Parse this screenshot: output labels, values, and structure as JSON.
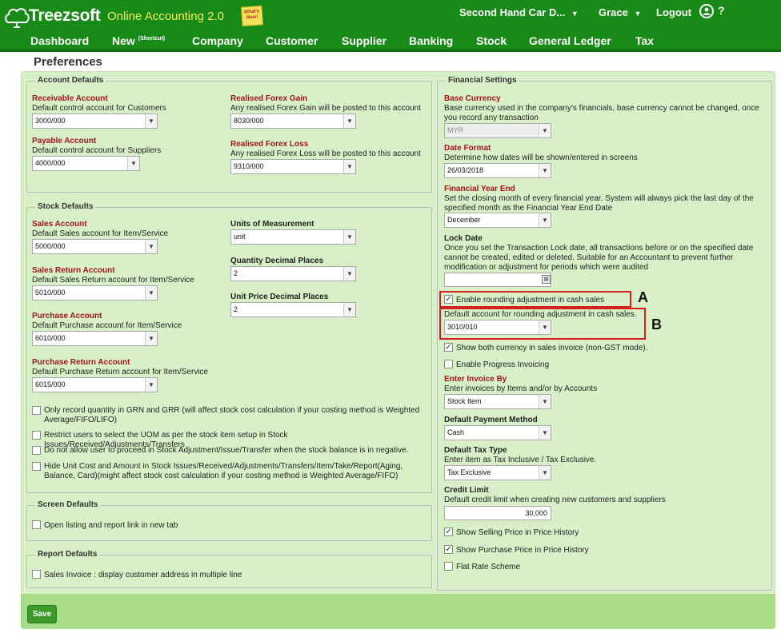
{
  "header": {
    "brand": "Treezsoft",
    "tagline": "Online Accounting 2.0",
    "sticky_note": "What's New!",
    "company": "Second Hand Car D...",
    "user": "Grace",
    "logout": "Logout",
    "help": "?",
    "nav": [
      {
        "label": "Dashboard"
      },
      {
        "label": "New",
        "sup": "(Shortcut)"
      },
      {
        "label": "Company"
      },
      {
        "label": "Customer"
      },
      {
        "label": "Supplier"
      },
      {
        "label": "Banking"
      },
      {
        "label": "Stock"
      },
      {
        "label": "General Ledger"
      },
      {
        "label": "Tax"
      }
    ]
  },
  "page_title": "Preferences",
  "account_defaults": {
    "legend": "Account Defaults",
    "receivable": {
      "label": "Receivable Account",
      "desc": "Default control account for Customers",
      "value": "3000/000"
    },
    "payable": {
      "label": "Payable Account",
      "desc": "Default control account for Suppliers",
      "value": "4000/000"
    },
    "forex_gain": {
      "label": "Realised Forex Gain",
      "desc": "Any realised Forex Gain will be posted to this account",
      "value": "8030/000"
    },
    "forex_loss": {
      "label": "Realised Forex Loss",
      "desc": "Any realised Forex Loss will be posted to this account",
      "value": "9310/000"
    }
  },
  "stock_defaults": {
    "legend": "Stock Defaults",
    "sales": {
      "label": "Sales Account",
      "desc": "Default Sales account for Item/Service",
      "value": "5000/000"
    },
    "sales_return": {
      "label": "Sales Return Account",
      "desc": "Default Sales Return account for Item/Service",
      "value": "5010/000"
    },
    "purchase": {
      "label": "Purchase Account",
      "desc": "Default Purchase account for Item/Service",
      "value": "6010/000"
    },
    "purchase_return": {
      "label": "Purchase Return Account",
      "desc": "Default Purchase Return account for Item/Service",
      "value": "6015/000"
    },
    "uom": {
      "label": "Units of Measurement",
      "value": "unit"
    },
    "qty_decimal": {
      "label": "Quantity Decimal Places",
      "value": "2"
    },
    "price_decimal": {
      "label": "Unit Price Decimal Places",
      "value": "2"
    },
    "options": [
      {
        "text": "Only record quantity in GRN and GRR (will affect stock cost calculation if your costing method is Weighted Average/FIFO/LIFO)",
        "checked": false
      },
      {
        "text": "Restrict users to select the UOM as per the stock item setup in Stock Issues/Received/Adjustments/Transfers",
        "checked": false
      },
      {
        "text": "Do not allow user to proceed in Stock Adjustment/Issue/Transfer when the stock balance is in negative.",
        "checked": false
      },
      {
        "text": "Hide Unit Cost and Amount in Stock Issues/Received/Adjustments/Transfers/Item/Take/Report(Aging, Balance, Card)(might affect stock cost calculation if your costing method is Weighted Average/FIFO)",
        "checked": false
      }
    ]
  },
  "screen_defaults": {
    "legend": "Screen Defaults",
    "option": {
      "text": "Open listing and report link in new tab",
      "checked": false
    }
  },
  "report_defaults": {
    "legend": "Report Defaults",
    "option": {
      "text": "Sales Invoice : display customer address in multiple line",
      "checked": false
    }
  },
  "financial_settings": {
    "legend": "Financial Settings",
    "base_currency": {
      "label": "Base Currency",
      "desc": "Base currency used in the company's financials, base currency cannot be changed, once you record any transaction",
      "value": "MYR"
    },
    "date_format": {
      "label": "Date Format",
      "desc": "Determine how dates will be shown/entered in screens",
      "value": "26/03/2018"
    },
    "fy_end": {
      "label": "Financial Year End",
      "desc": "Set the closing month of every financial year. System will always pick the last day of the specified month as the Financial Year End Date",
      "value": "December"
    },
    "lock_date": {
      "label": "Lock Date",
      "desc": "Once you set the Transaction Lock date, all transactions before or on the specified date cannot be created, edited or deleted. Suitable for an Accountant to prevent further modification or adjustment for periods which were audited",
      "value": ""
    },
    "rounding": {
      "text": "Enable rounding adjustment in cash sales",
      "checked": true,
      "marker": "A"
    },
    "rounding_account": {
      "desc": "Default account for rounding adjustment in cash sales.",
      "value": "3010/010",
      "marker": "B"
    },
    "show_both_currency": {
      "text": "Show both currency in sales invoice (non-GST mode).",
      "checked": true
    },
    "progress_invoicing": {
      "text": "Enable Progress Invoicing",
      "checked": false
    },
    "enter_invoice_by": {
      "label": "Enter Invoice By",
      "desc": "Enter invoices by Items and/or by Accounts",
      "value": "Stock Item"
    },
    "payment_method": {
      "label": "Default Payment Method",
      "value": "Cash"
    },
    "tax_type": {
      "label": "Default Tax Type",
      "desc": "Enter item as Tax Inclusive / Tax Exclusive.",
      "value": "Tax Exclusive"
    },
    "credit_limit": {
      "label": "Credit Limit",
      "desc": "Default credit limit when creating new customers and suppliers",
      "value": "30,000"
    },
    "show_selling_price": {
      "text": "Show Selling Price in Price History",
      "checked": true
    },
    "show_purchase_price": {
      "text": "Show Purchase Price in Price History",
      "checked": true
    },
    "flat_rate": {
      "text": "Flat Rate Scheme",
      "checked": false
    }
  },
  "save_label": "Save",
  "colors": {
    "header": "#178a17",
    "tagline": "#f2ef5f",
    "panel": "#d8f0c8",
    "label_red": "#a6141b",
    "highlight": "#d6201f"
  }
}
